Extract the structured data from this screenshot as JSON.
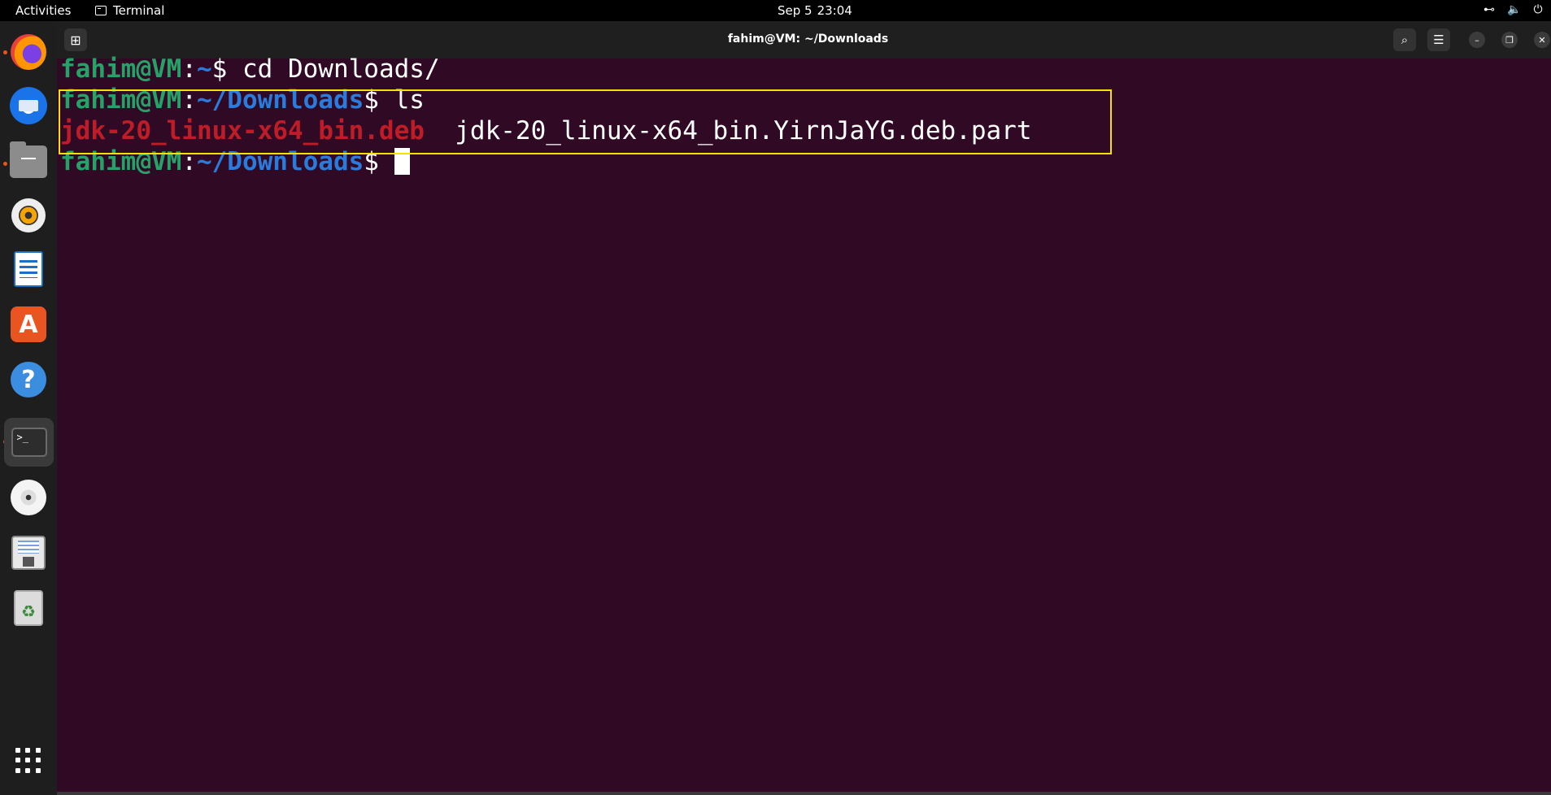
{
  "topbar": {
    "activities": "Activities",
    "app_name": "Terminal",
    "date": "Sep 5",
    "time": "23:04",
    "tray_icons": [
      "network-icon",
      "volume-icon",
      "power-icon"
    ]
  },
  "dock": {
    "items": [
      {
        "name": "firefox",
        "running": true
      },
      {
        "name": "thunderbird",
        "running": false
      },
      {
        "name": "files",
        "running": true
      },
      {
        "name": "rhythmbox",
        "running": false
      },
      {
        "name": "libreoffice-writer",
        "running": false
      },
      {
        "name": "app-center",
        "running": false
      },
      {
        "name": "help",
        "running": false
      },
      {
        "name": "terminal",
        "running": true,
        "active": true
      },
      {
        "name": "dvd-drive",
        "running": false
      },
      {
        "name": "disk-image",
        "running": false
      },
      {
        "name": "trash",
        "running": false
      },
      {
        "name": "show-apps",
        "running": false
      }
    ],
    "help_glyph": "?",
    "store_glyph": "A",
    "terminal_glyph": ">_",
    "trash_glyph": "♻"
  },
  "window": {
    "title": "fahim@VM: ~/Downloads",
    "buttons": [
      "new-tab",
      "search",
      "menu",
      "minimize",
      "maximize",
      "close"
    ],
    "glyphs": {
      "new_tab": "⊞",
      "search": "⌕",
      "menu": "☰",
      "minimize": "–",
      "maximize": "❐",
      "close": "✕"
    }
  },
  "terminal": {
    "line1": {
      "user": "fahim@VM",
      "sep": ":",
      "path": "~",
      "prompt": "$ ",
      "command": "cd Downloads/"
    },
    "line2": {
      "user": "fahim@VM",
      "sep": ":",
      "path": "~/Downloads",
      "prompt": "$ ",
      "command": "ls"
    },
    "line3": {
      "file1": "jdk-20_linux-x64_bin.deb",
      "gap": "  ",
      "file2": "jdk-20_linux-x64_bin.YirnJaYG.deb.part"
    },
    "line4": {
      "user": "fahim@VM",
      "sep": ":",
      "path": "~/Downloads",
      "prompt": "$ "
    }
  },
  "colors": {
    "terminal_bg": "#300a24",
    "user": "#26a269",
    "path": "#2a7bde",
    "deb_file": "#c01c28",
    "highlight_box": "#f5e00a",
    "running_dot": "#e95420"
  }
}
